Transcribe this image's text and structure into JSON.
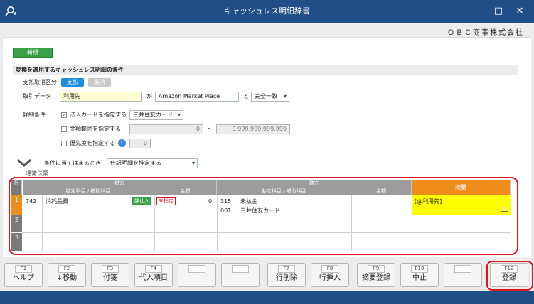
{
  "titlebar": {
    "title": "キャッシュレス明細辞書",
    "app_icon": "search-plus-icon",
    "minimize": "–",
    "maximize": "□",
    "close": "✕"
  },
  "company": "ＯＢＣ商事株式会社",
  "new_badge": "新規",
  "conditions": {
    "header": "変換を適用するキャッシュレス明細の条件",
    "payment_label": "支払取消区分",
    "payment_active": "支払",
    "payment_inactive": "取消",
    "trade_label": "取引データ",
    "trade_field": "利用先",
    "ga": "が",
    "trade_value": "Amazon Market Place",
    "to": "と",
    "match": "完全一致",
    "detail_label": "詳細条件",
    "corp_card_label": "法人カードを指定する",
    "corp_card_value": "三井住友カード",
    "amount_label": "金額範囲を指定する",
    "amount_from": "0",
    "tilde": "〜",
    "amount_to": "9,999,999,999,999",
    "priority_label": "優先度を指定する",
    "priority_info": "i",
    "priority_value": "0",
    "check": "✓"
  },
  "rule": {
    "label": "条件に当てはまるとき",
    "value": "仕訳明細を推定する",
    "voucher_type": "通常伝票"
  },
  "grid": {
    "row_header": "行",
    "debit": "借方",
    "credit": "貸方",
    "account_header": "勘定科目 / 補助科目",
    "amount_header": "金額",
    "memo_header": "摘要",
    "rows": [
      {
        "no": "1",
        "debit_code": "742",
        "debit_account": "消耗品費",
        "tax_tag": "課仕入",
        "unspecified_tag": "未指定",
        "debit_amount": "0",
        "credit_code": "315",
        "credit_account": "未払金",
        "credit_sub_code": "001",
        "credit_sub_account": "三井住友カード",
        "memo": "[@利用先]"
      },
      {
        "no": "2"
      },
      {
        "no": "3"
      }
    ]
  },
  "function_keys": [
    {
      "key": "F1",
      "label": "ヘルプ"
    },
    {
      "key": "F2",
      "label": "↓移動"
    },
    {
      "key": "F3",
      "label": "付箋"
    },
    {
      "key": "F4",
      "label": "代入項目"
    },
    {
      "key": "",
      "label": ""
    },
    {
      "key": "",
      "label": ""
    },
    {
      "key": "F7",
      "label": "行削除"
    },
    {
      "key": "F8",
      "label": "行挿入"
    },
    {
      "key": "F9",
      "label": "摘要登録"
    },
    {
      "key": "F10",
      "label": "中止"
    },
    {
      "key": "",
      "label": ""
    },
    {
      "key": "F12",
      "label": "登録"
    }
  ],
  "colors": {
    "titlebar": "#1f4f86",
    "accent_blue": "#1e8fe0",
    "new_green": "#3aa04a",
    "memo_header": "#f08c1a",
    "memo_cell": "#ffff00",
    "highlight": "#e0141e"
  }
}
